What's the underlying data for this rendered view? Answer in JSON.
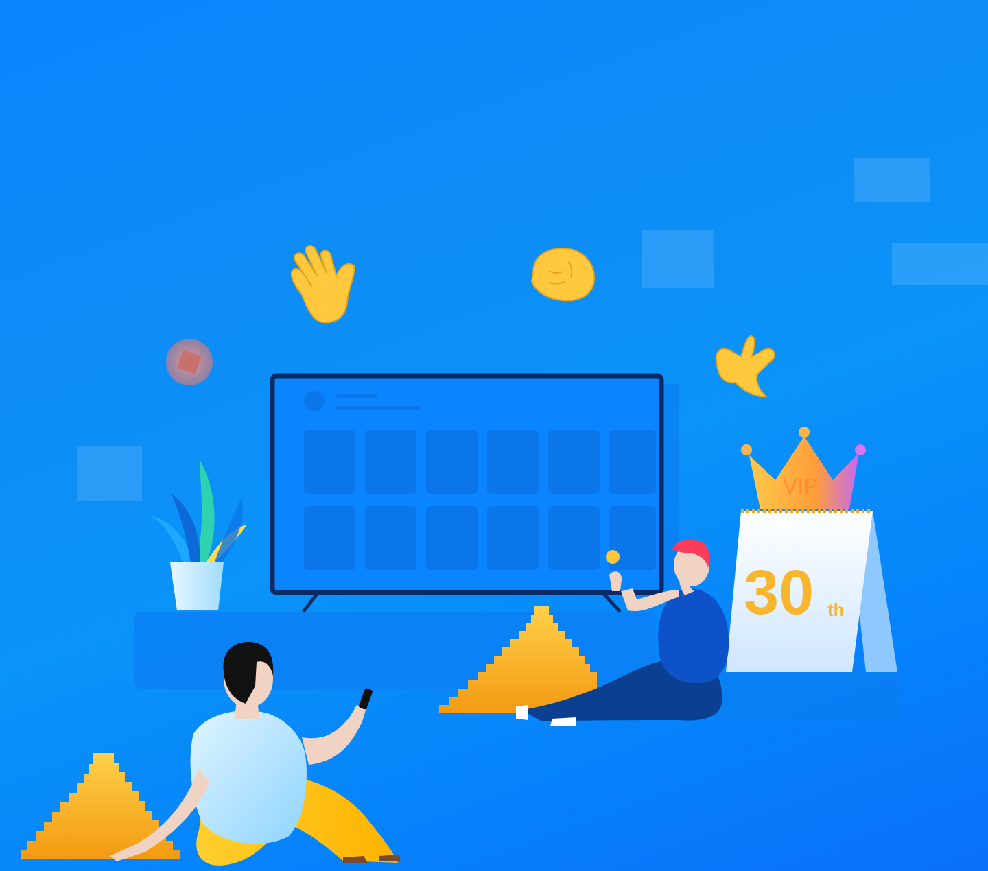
{
  "illustration": {
    "vip_badge": {
      "label": "VIP"
    },
    "calendar": {
      "day_number": "30",
      "day_suffix": "th"
    },
    "colors": {
      "background_top": "#0a86ff",
      "background_bottom": "#0a6ff9",
      "tv_frame": "#0b2a66",
      "tv_screen": "#0b84ff",
      "gold": "#f6b21c",
      "emoji_yellow": "#ffc83d",
      "crown_gradient_end": "#c46af5",
      "calendar_number": "#f7b62e"
    },
    "icons": [
      "waving-hand-icon",
      "raised-fist-icon",
      "call-me-hand-icon",
      "pink-orb-icon",
      "crown-icon",
      "potted-plant-icon",
      "remote-control-icon",
      "coin-icon"
    ]
  }
}
